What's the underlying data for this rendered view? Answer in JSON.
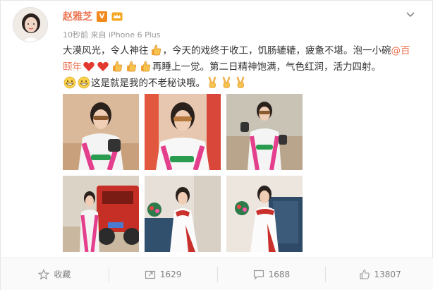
{
  "user": {
    "name": "赵雅芝",
    "verified_mark": "V"
  },
  "post": {
    "time": "10秒前",
    "source_prefix": "来自",
    "source": "iPhone 6 Plus",
    "line1_a": "大漠风光，令人神往",
    "line1_b": "，今天的戏终于收工，饥肠辘辘，疲惫不堪。泡一小碗",
    "mention": "@百颐年",
    "line2_b": "再睡上一觉。第二日精神饱满，气色红润，活力四射。",
    "line3_b": "这是就是我的不老秘诀哦。"
  },
  "photos": [
    {
      "subject": "racing-suit-portrait"
    },
    {
      "subject": "racing-suit-sunglasses"
    },
    {
      "subject": "racing-suit-gloves"
    },
    {
      "subject": "standing-by-red-truck"
    },
    {
      "subject": "white-gown-seated"
    },
    {
      "subject": "white-gown-chair"
    }
  ],
  "actions": {
    "favorite": "收藏",
    "repost": "1629",
    "comment": "1688",
    "like": "13807"
  },
  "colors": {
    "name": "#eb7350",
    "link": "#eb7350",
    "muted": "#999999",
    "suit_pink": "#e43f8d",
    "suit_green": "#2a9c4f"
  }
}
